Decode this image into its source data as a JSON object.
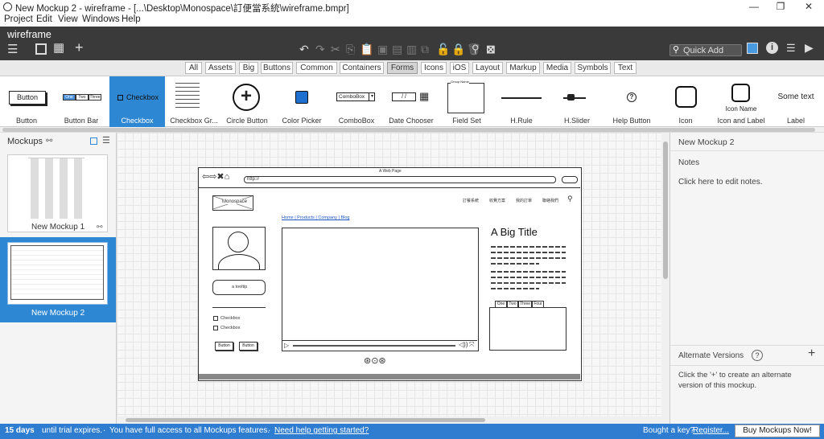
{
  "window": {
    "title": "New Mockup 2 - wireframe - [...\\Desktop\\Monospace\\訂便當系統\\wireframe.bmpr]",
    "minimize": "—",
    "restore": "❐",
    "close": "✕"
  },
  "menu": [
    "Project",
    "Edit",
    "View",
    "Windows",
    "Help"
  ],
  "toolbar": {
    "project_name": "wireframe",
    "quick_add_placeholder": "Quick Add"
  },
  "filters": [
    "All",
    "Assets",
    "Big",
    "Buttons",
    "Common",
    "Containers",
    "Forms",
    "Icons",
    "iOS",
    "Layout",
    "Markup",
    "Media",
    "Symbols",
    "Text"
  ],
  "selected_filter": "Forms",
  "components": [
    {
      "label": "Button",
      "preview": "Button"
    },
    {
      "label": "Button Bar",
      "preview": [
        "One",
        "Two",
        "Three"
      ]
    },
    {
      "label": "Checkbox",
      "preview": "Checkbox"
    },
    {
      "label": "Checkbox Gr...",
      "preview": ""
    },
    {
      "label": "Circle Button",
      "preview": "+"
    },
    {
      "label": "Color Picker",
      "preview": ""
    },
    {
      "label": "ComboBox",
      "preview": "ComboBox"
    },
    {
      "label": "Date Chooser",
      "preview": "/ /"
    },
    {
      "label": "Field Set",
      "preview": "Group Name"
    },
    {
      "label": "H.Rule",
      "preview": ""
    },
    {
      "label": "H.Slider",
      "preview": ""
    },
    {
      "label": "Help Button",
      "preview": "?"
    },
    {
      "label": "Icon",
      "preview": ""
    },
    {
      "label": "Icon and Label",
      "preview": "Icon Name"
    },
    {
      "label": "Label",
      "preview": "Some text"
    }
  ],
  "left_panel": {
    "title": "Mockups",
    "mockups": [
      "New Mockup 1",
      "New Mockup 2"
    ]
  },
  "right_panel": {
    "mockup_name": "New Mockup 2",
    "notes_title": "Notes",
    "notes_placeholder": "Click here to edit notes.",
    "alt_title": "Alternate Versions",
    "alt_help": "?",
    "alt_desc_1": "Click the '+' to create an alternate",
    "alt_desc_2": "version of this mockup."
  },
  "mockup": {
    "page_title": "A Web Page",
    "url": "http://",
    "logo": "Monospace",
    "nav": [
      "訂餐系統",
      "收費方案",
      "我的訂單",
      "聯絡我們"
    ],
    "breadcrumb": [
      "Home",
      "Products",
      "Company",
      "Blog"
    ],
    "big_title": "A Big Title",
    "tooltip": "a tooltip",
    "checkboxes": [
      "Checkbox",
      "Checkbox"
    ],
    "buttons": [
      "Button",
      "Button"
    ],
    "tabs": [
      "One",
      "Two",
      "Three",
      "Four"
    ]
  },
  "status": {
    "days": "15 days",
    "trial_text": "until trial expires.",
    "access_text": "You have full access to all Mockups features.",
    "help_link": "Need help getting started?",
    "key_text": "Bought a key?",
    "register_link": "Register...",
    "buy_button": "Buy Mockups Now!"
  }
}
